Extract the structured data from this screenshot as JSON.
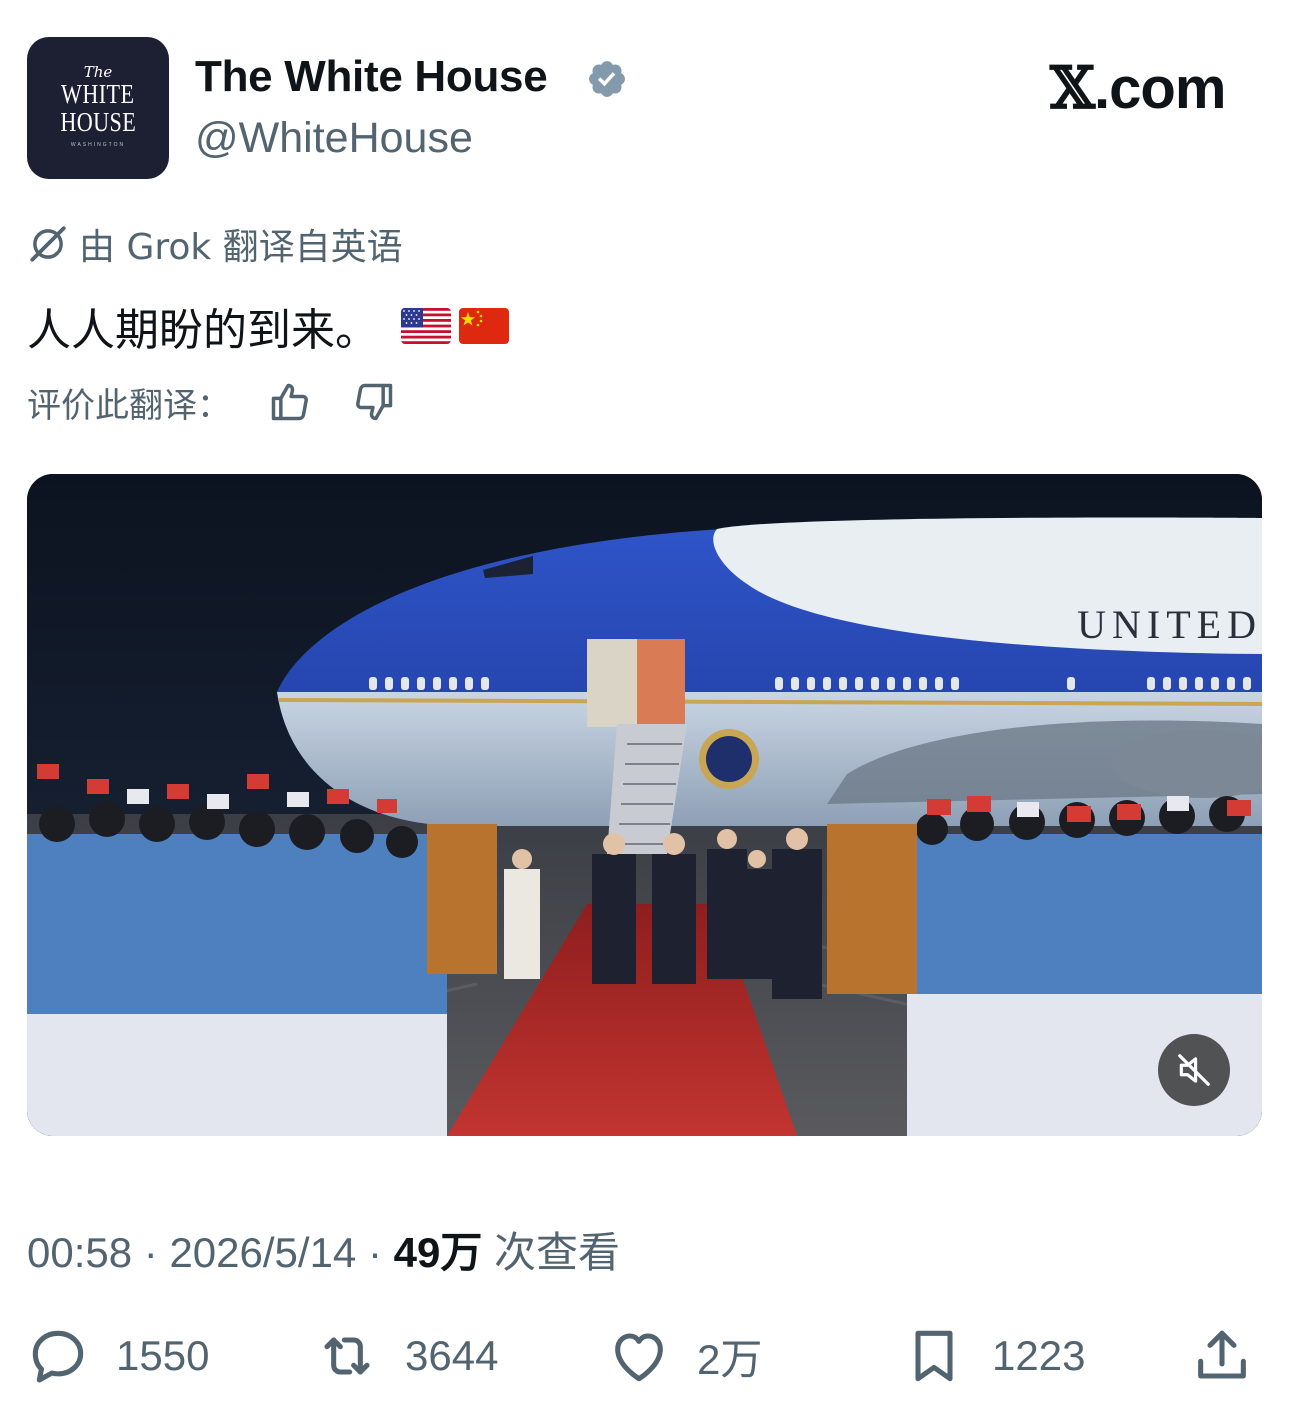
{
  "account": {
    "avatar_line_the": "The",
    "avatar_line1": "WHITE",
    "avatar_line2": "HOUSE",
    "avatar_subtitle": "WASHINGTON",
    "display_name": "The White House",
    "verified_icon": "verified-badge-icon",
    "handle": "@WhiteHouse"
  },
  "site": {
    "logo_mark": "𝕏",
    "logo_text": ".com"
  },
  "post": {
    "translated_icon": "grok-icon",
    "translated_note": "由 Grok 翻译自英语",
    "text": "人人期盼的到来。",
    "emoji": [
      "us-flag",
      "china-flag"
    ],
    "rate_label": "评价此翻译：",
    "rate_icons": [
      "thumbs-up-icon",
      "thumbs-down-icon"
    ]
  },
  "media": {
    "type": "video",
    "aircraft_text": "UNITED",
    "mute_icon": "mute-icon"
  },
  "meta": {
    "time": "00:58",
    "separator": " · ",
    "date": "2026/5/14",
    "views_count": "49万",
    "views_label": " 次查看"
  },
  "actions": {
    "reply_count": "1550",
    "repost_count": "3644",
    "like_count": "2万",
    "bookmark_count": "1223"
  },
  "colors": {
    "text_primary": "#0f1419",
    "text_secondary": "#536471",
    "avatar_bg": "#1d1f33",
    "verified": "#829aab",
    "plane_blue": "#2a49b8",
    "carpet_red": "#b52a27"
  }
}
